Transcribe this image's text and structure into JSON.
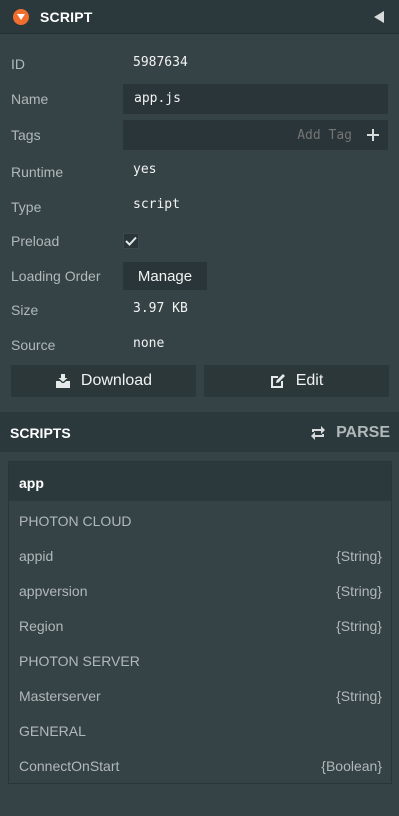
{
  "header": {
    "title": "SCRIPT"
  },
  "attributes": {
    "id_label": "ID",
    "id_value": "5987634",
    "name_label": "Name",
    "name_value": "app.js",
    "tags_label": "Tags",
    "tags_placeholder": "Add Tag",
    "runtime_label": "Runtime",
    "runtime_value": "yes",
    "type_label": "Type",
    "type_value": "script",
    "preload_label": "Preload",
    "preload_checked": true,
    "loading_order_label": "Loading Order",
    "manage_label": "Manage",
    "size_label": "Size",
    "size_value": "3.97 KB",
    "source_label": "Source",
    "source_value": "none"
  },
  "actions": {
    "download_label": "Download",
    "edit_label": "Edit"
  },
  "scripts": {
    "title": "SCRIPTS",
    "parse_label": "PARSE",
    "script_name": "app",
    "rows": [
      {
        "label": "PHOTON CLOUD",
        "type": ""
      },
      {
        "label": "appid",
        "type": "{String}"
      },
      {
        "label": "appversion",
        "type": "{String}"
      },
      {
        "label": "Region",
        "type": "{String}"
      },
      {
        "label": "PHOTON SERVER",
        "type": ""
      },
      {
        "label": "Masterserver",
        "type": "{String}"
      },
      {
        "label": "GENERAL",
        "type": ""
      },
      {
        "label": "ConnectOnStart",
        "type": "{Boolean}"
      }
    ]
  },
  "colors": {
    "accent": "#f06e2e",
    "panel_bg": "#364346",
    "header_bg": "#2c393c",
    "field_bg": "#293538"
  }
}
